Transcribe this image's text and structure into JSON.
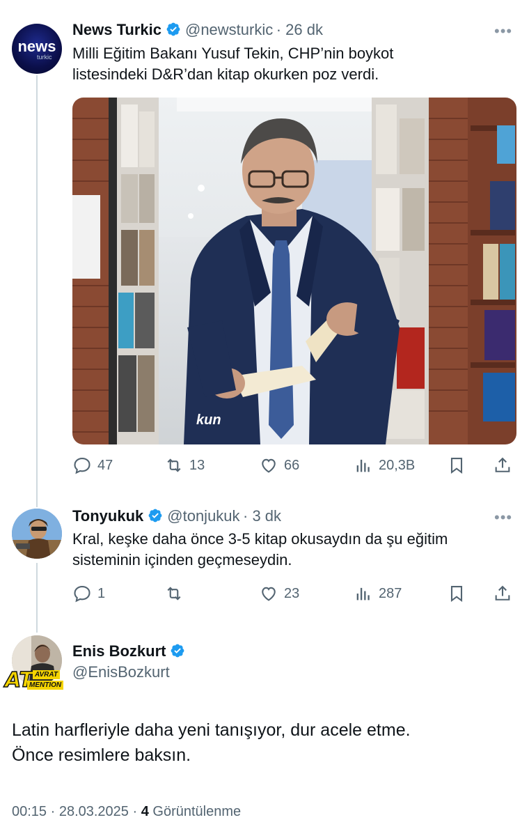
{
  "tweets": [
    {
      "name": "News Turkic",
      "handle": "@newsturkic",
      "time": "· 26 dk",
      "avatar_text": "news",
      "avatar_sub": "turkic",
      "text_line1": "Milli Eğitim Bakanı Yusuf Tekin, CHP’nin boykot",
      "text_line2": "listesindeki D&R’dan kitap okurken poz verdi.",
      "replies": "47",
      "retweets": "13",
      "likes": "66",
      "views": "20,3B"
    },
    {
      "name": "Tonyukuk",
      "handle": "@tonjukuk",
      "time": "· 3 dk",
      "text_line1": "Kral, keşke daha önce 3-5 kitap okusaydın da şu eğitim",
      "text_line2": "sisteminin içinden geçmeseydin.",
      "replies": "1",
      "retweets": "",
      "likes": "23",
      "views": "287"
    }
  ],
  "main": {
    "name": "Enis Bozkurt",
    "handle": "@EnisBozkurt",
    "badge_big": "AT",
    "badge_top": "AVRAT",
    "badge_bottom": "MENTION",
    "text_line1": "Latin harfleriyle daha yeni tanışıyor, dur acele etme.",
    "text_line2": "Önce resimlere baksın.",
    "meta_time": "00:15 · 28.03.2025 · ",
    "meta_views_count": "4",
    "meta_views_label": " Görüntülenme"
  },
  "media_overlay_text": "kun",
  "colors": {
    "accent": "#1d9bf0",
    "secondary_text": "#536471",
    "line": "#cfd9de"
  }
}
